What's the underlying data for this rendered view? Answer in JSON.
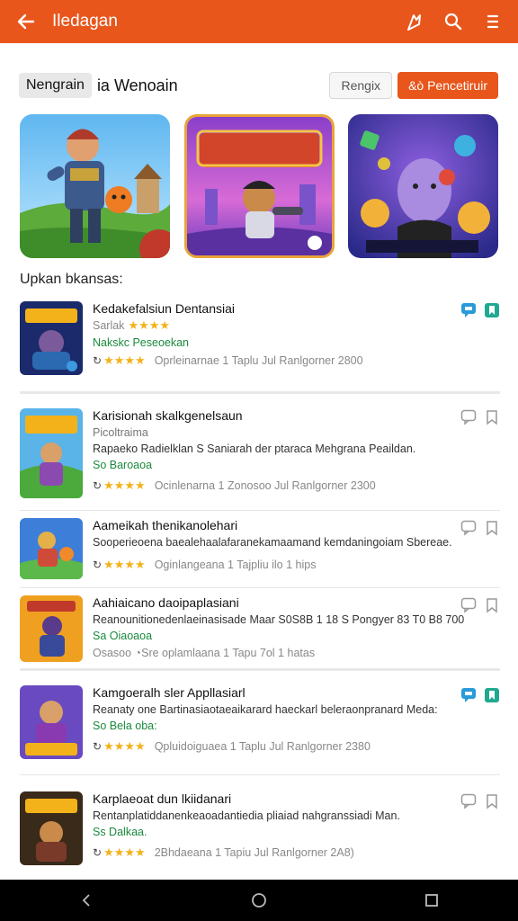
{
  "appbar": {
    "title": "Iledagan",
    "back_icon": "back-arrow-icon",
    "actions": [
      "sort-icon",
      "search-icon",
      "menu-icon"
    ],
    "color": "#e8561c"
  },
  "filter": {
    "chip": "Nengrain",
    "title": "ia Wenoain",
    "secondary_button": "Rengix",
    "primary_button": "&ò Pencetiruir"
  },
  "section_title": "Upkan bkansas:",
  "items": [
    {
      "name": "Kedakefalsiun Dentansiai",
      "rating_line": "Sarlak",
      "tag": "Nakskc Peseoekan",
      "meta": "Oprleinarnae 1 Taplu Jul Ranlgorner 2800",
      "highlight": true
    },
    {
      "name": "Karisionah skalkgenelsaun",
      "subname": "Picoltraima",
      "desc": "Rapaeko Radielklan S Saniarah der ptaraca Mehgrana Peaildan.",
      "tag": "So Baroaoa",
      "meta": "Ocinlenarna 1 Zonosoo Jul Ranlgorner 2300",
      "highlight": false
    },
    {
      "name": "Aameikah thenikanolehari",
      "desc": "Sooperieoena baealehaalafaranekamaamand kemdaningoiam Sbereae.",
      "meta": "Oginlangeana 1 Tajpliu ilo 1 hips",
      "highlight": false
    },
    {
      "name": "Aahiaicano daoipaplasiani",
      "desc": "Reanounitionedenlaeinasisade Maar S0S8B 1 18 S Pongyer 83 T0 B8 700",
      "tag": "Sa Oiaoaoa",
      "meta": "Osasoo  ◔Sre oplamlaana 1 Tapu 7ol 1 hatas",
      "highlight": false
    },
    {
      "name": "Kamgoeralh sler Appllasiarl",
      "desc": "Reanaty one Bartinasiaotaeaikarard haeckarl beleraonpranard Meda:",
      "tag": "So Bela oba:",
      "meta": "Qpluidoiguaea 1 Taplu Jul Ranlgorner 2380",
      "highlight": true
    },
    {
      "name": "Karplaeoat dun lkiidanari",
      "desc": "Rentanplatiddanenkeaoadantiedia pliaiad nahgranssiadi Man.",
      "tag": "Ss Dalkaa.",
      "meta": "2Bhdaeana 1 Tapiu Jul Ranlgorner 2A8)",
      "highlight": false
    }
  ],
  "navbar": [
    "back-triangle-icon",
    "home-circle-icon",
    "recents-square-icon"
  ]
}
